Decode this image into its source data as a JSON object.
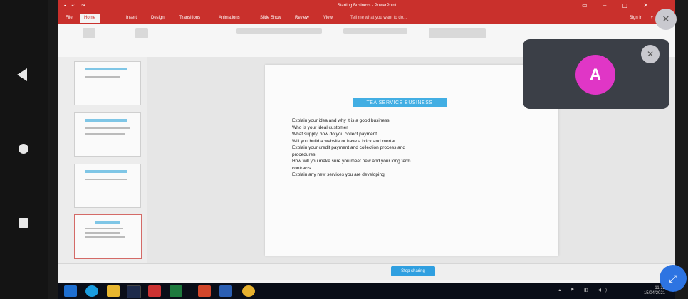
{
  "window": {
    "title": "Starting Business - PowerPoint"
  },
  "ribbon_tabs": [
    "File",
    "Home",
    "Insert",
    "Design",
    "Transitions",
    "Animations",
    "Slide Show",
    "Review",
    "View"
  ],
  "active_tab": "Home",
  "tell_me": "Tell me what you want to do...",
  "signin": "Sign in",
  "slide": {
    "title": "TEA SERVICE BUSINESS",
    "body": [
      "Explain your idea and why it is a good business",
      "Who is your ideal customer",
      "What supply, how do you collect payment",
      "Will you build a website or have a brick and mortar",
      "Explain your credit payment and collection process and",
      "procedures",
      "How will you make sure you meet new and your long term",
      "contracts",
      "Explain any new services you are developing"
    ]
  },
  "participant": {
    "initial": "A"
  },
  "stop_button": "Stop sharing",
  "tray": {
    "time": "11:32",
    "date": "15/04/2021"
  },
  "colors": {
    "accent": "#c9302c",
    "avatar": "#e036c6",
    "title_bg": "#42aee3"
  }
}
